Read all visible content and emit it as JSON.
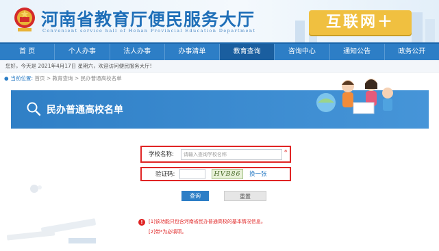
{
  "header": {
    "title": "河南省教育厅便民服务大厅",
    "subtitle": "Convenient service hall of Henan Provincial Education Department",
    "badge": "互联网＋"
  },
  "nav": {
    "items": [
      {
        "label": "首 页",
        "active": false
      },
      {
        "label": "个人办事",
        "active": false
      },
      {
        "label": "法人办事",
        "active": false
      },
      {
        "label": "办事清单",
        "active": false
      },
      {
        "label": "教育查询",
        "active": true
      },
      {
        "label": "咨询中心",
        "active": false
      },
      {
        "label": "通知公告",
        "active": false
      },
      {
        "label": "政务公开",
        "active": false
      }
    ]
  },
  "welcome": "您好，今天是 2021年4月17日 星期六，欢迎访问便民服务大厅!",
  "breadcrumb": {
    "label": "当前位置:",
    "path": "首页 > 教育查询 > 民办普通高校名单"
  },
  "banner": {
    "title": "民办普通高校名单"
  },
  "form": {
    "school_label": "学校名称:",
    "school_placeholder": "请输入查询学校名称",
    "required_mark": "*",
    "captcha_label": "验证码:",
    "captcha_text": "HVB86",
    "refresh_label": "换一张",
    "query_button": "查询",
    "reset_button": "重置"
  },
  "notice": {
    "icon": "!",
    "lines": [
      "[1]该功能只包含河南省民办普通高校的基本情况信息。",
      "[2]带*为必填项。"
    ]
  },
  "colors": {
    "primary": "#2d7ec6",
    "accent_red": "#e02424",
    "badge_yellow": "#f0c040"
  }
}
